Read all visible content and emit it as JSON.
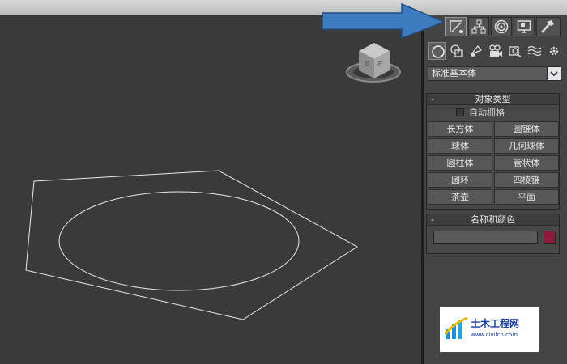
{
  "panel": {
    "tabs": [
      "create-tab",
      "modify-tab",
      "hierarchy-tab",
      "motion-tab",
      "display-tab",
      "utilities-tab"
    ],
    "subcategories": [
      "geometry",
      "shapes",
      "lights",
      "cameras",
      "helpers",
      "space-warps",
      "systems"
    ],
    "category_dropdown": "标准基本体",
    "object_type": {
      "title": "对象类型",
      "collapse": "-",
      "autogrid_label": "自动栅格",
      "buttons": [
        {
          "label": "长方体"
        },
        {
          "label": "圆锥体"
        },
        {
          "label": "球体"
        },
        {
          "label": "几何球体"
        },
        {
          "label": "圆柱体"
        },
        {
          "label": "管状体"
        },
        {
          "label": "圆环"
        },
        {
          "label": "四棱锥"
        },
        {
          "label": "茶壶"
        },
        {
          "label": "平面"
        }
      ]
    },
    "name_color": {
      "title": "名称和颜色",
      "collapse": "-",
      "name_value": "",
      "object_color": "#8b1c3e"
    }
  },
  "watermark": {
    "text": "土木工程网",
    "url": "www.civilcn.com"
  },
  "colors": {
    "arrow": "#3e7cc0",
    "viewport": "#3a3a3a",
    "shape_lines": "#e8e8e8"
  }
}
